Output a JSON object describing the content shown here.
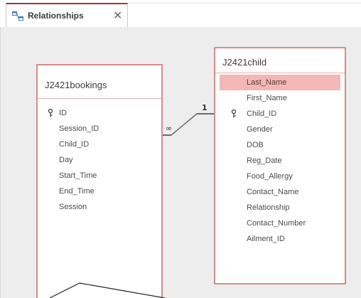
{
  "tab": {
    "label": "Relationships",
    "close_label": "✕",
    "icon": "relationships-icon"
  },
  "bookings": {
    "title": "J2421bookings",
    "fields": [
      {
        "name": "ID",
        "key": true
      },
      {
        "name": "Session_ID",
        "key": false
      },
      {
        "name": "Child_ID",
        "key": false
      },
      {
        "name": "Day",
        "key": false
      },
      {
        "name": "Start_Time",
        "key": false
      },
      {
        "name": "End_Time",
        "key": false
      },
      {
        "name": "Session",
        "key": false
      }
    ]
  },
  "child": {
    "title": "J2421child",
    "fields": [
      {
        "name": "Last_Name",
        "key": false,
        "selected": true
      },
      {
        "name": "First_Name",
        "key": false
      },
      {
        "name": "Child_ID",
        "key": true
      },
      {
        "name": "Gender",
        "key": false
      },
      {
        "name": "DOB",
        "key": false
      },
      {
        "name": "Reg_Date",
        "key": false
      },
      {
        "name": "Food_Allergy",
        "key": false
      },
      {
        "name": "Contact_Name",
        "key": false
      },
      {
        "name": "Relationship",
        "key": false
      },
      {
        "name": "Contact_Number",
        "key": false
      },
      {
        "name": "Ailment_ID",
        "key": false
      }
    ]
  },
  "relationship": {
    "many_label": "∞",
    "one_label": "1"
  },
  "colors": {
    "accent": "#a4373a",
    "table_border": "#d98b8b",
    "selected_row": "#f4b6b6",
    "canvas": "#ededed"
  }
}
